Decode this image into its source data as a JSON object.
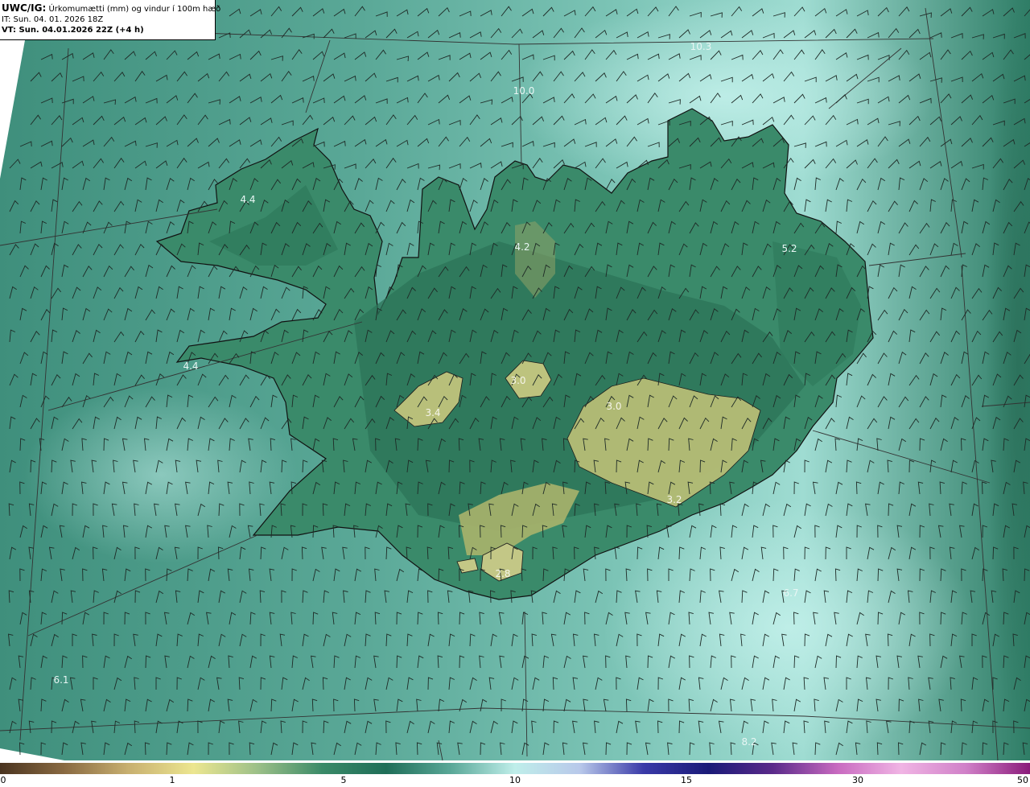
{
  "header": {
    "model_code": "UWC/IG:",
    "title": "Úrkomumætti (mm) og vindur í 100m hæð",
    "init_time": "IT: Sun. 04. 01. 2026 18Z",
    "valid_time": "VT: Sun. 04.01.2026 22Z (+4 h)"
  },
  "colorbar": {
    "ticks": [
      "0",
      "1",
      "5",
      "10",
      "15",
      "30",
      "50"
    ],
    "colors": [
      "#4a3420",
      "#8a6a42",
      "#c8b070",
      "#ece690",
      "#9cc088",
      "#3a8a68",
      "#1f6e58",
      "#5aa898",
      "#bfeeea",
      "#b8c8ea",
      "#3a3aa8",
      "#1a1a78",
      "#5a2a8a",
      "#c86ac0",
      "#f0b4e4",
      "#d080c8",
      "#8a1a7a"
    ]
  },
  "map_values": [
    {
      "text": "10.3"
    },
    {
      "text": "10.0"
    },
    {
      "text": "4.4"
    },
    {
      "text": "4.2"
    },
    {
      "text": "5.2"
    },
    {
      "text": "4.4"
    },
    {
      "text": "3.0"
    },
    {
      "text": "3.4"
    },
    {
      "text": "3.0"
    },
    {
      "text": "3.2"
    },
    {
      "text": "2.8"
    },
    {
      "text": "6.7"
    },
    {
      "text": "6.1"
    },
    {
      "text": "8.2"
    }
  ],
  "colors": {
    "sea": "#4f9e8c",
    "sea_light": "#a6ded6",
    "land_dark": "#2e7d62",
    "highland": "#b6bd76",
    "coast": "#111111",
    "barb": "#222222",
    "grid": "#333333"
  }
}
